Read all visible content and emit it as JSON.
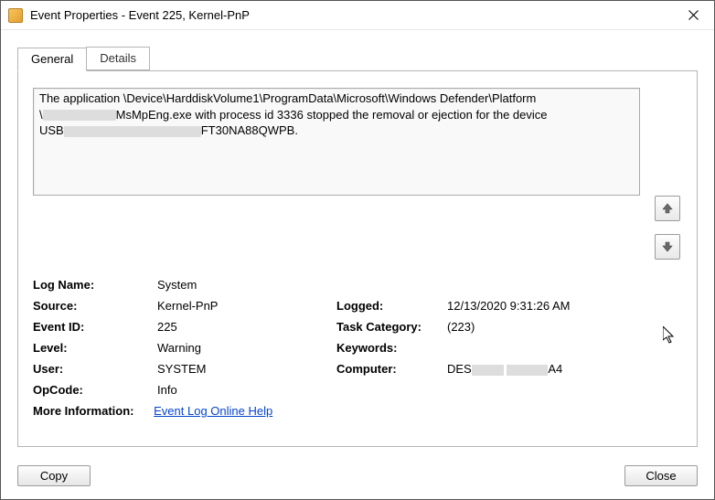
{
  "window": {
    "title": "Event Properties - Event 225, Kernel-PnP"
  },
  "tabs": {
    "general": "General",
    "details": "Details"
  },
  "description": {
    "line1": "The application \\Device\\HarddiskVolume1\\ProgramData\\Microsoft\\Windows Defender\\Platform",
    "line2a": "\\",
    "line2b": "MsMpEng.exe with process id 3336 stopped the removal or ejection for the device",
    "line3a": "USB",
    "line3b": "FT30NA88QWPB."
  },
  "fields": {
    "log_name_label": "Log Name:",
    "log_name": "System",
    "source_label": "Source:",
    "source": "Kernel-PnP",
    "logged_label": "Logged:",
    "logged": "12/13/2020 9:31:26 AM",
    "event_id_label": "Event ID:",
    "event_id": "225",
    "task_category_label": "Task Category:",
    "task_category": "(223)",
    "level_label": "Level:",
    "level": "Warning",
    "keywords_label": "Keywords:",
    "keywords": "",
    "user_label": "User:",
    "user": "SYSTEM",
    "computer_label": "Computer:",
    "computer_prefix": "DES",
    "computer_suffix": "A4",
    "opcode_label": "OpCode:",
    "opcode": "Info",
    "more_info_label": "More Information:",
    "more_info_link": "Event Log Online Help"
  },
  "buttons": {
    "copy": "Copy",
    "close": "Close"
  }
}
